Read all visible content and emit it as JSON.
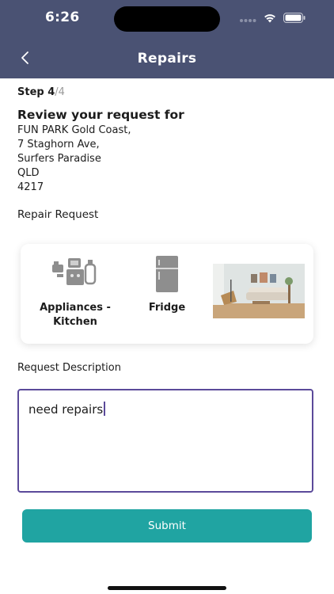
{
  "status": {
    "time": "6:26"
  },
  "nav": {
    "title": "Repairs"
  },
  "step": {
    "label": "Step 4",
    "separator": "/",
    "total": "4"
  },
  "review": {
    "title": "Review your request for",
    "address": [
      "FUN PARK Gold Coast,",
      "7 Staghorn Ave,",
      "Surfers Paradise",
      "QLD",
      "4217"
    ]
  },
  "repair_request": {
    "label": "Repair Request",
    "items": [
      {
        "label_line1": "Appliances -",
        "label_line2": "Kitchen",
        "icon": "kitchen-appliances-icon"
      },
      {
        "label_line1": "Fridge",
        "icon": "fridge-icon"
      },
      {
        "image": "living-room-photo"
      }
    ]
  },
  "description": {
    "label": "Request Description",
    "value": "need repairs"
  },
  "submit": {
    "label": "Submit"
  },
  "colors": {
    "header": "#4a5273",
    "accent": "#20a4a2",
    "field_border": "#5b4a9a"
  }
}
